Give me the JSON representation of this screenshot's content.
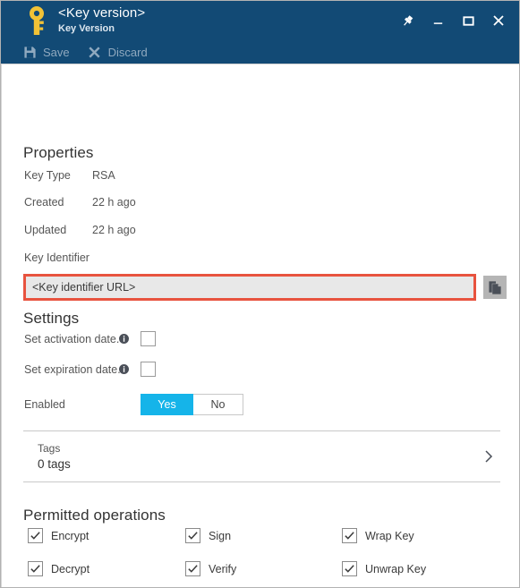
{
  "window": {
    "title": "<Key version>",
    "subtitle": "Key Version",
    "icon": "key-icon",
    "buttons": [
      {
        "name": "pin-button",
        "icon": "pin-icon"
      },
      {
        "name": "minimize-button",
        "icon": "minimize-icon"
      },
      {
        "name": "maximize-button",
        "icon": "maximize-icon"
      },
      {
        "name": "close-button",
        "icon": "close-icon"
      }
    ]
  },
  "commandbar": {
    "items": [
      {
        "name": "save-button",
        "label": "Save",
        "icon": "save-icon",
        "enabled": false
      },
      {
        "name": "discard-button",
        "label": "Discard",
        "icon": "discard-icon",
        "enabled": false
      }
    ]
  },
  "properties": {
    "heading": "Properties",
    "rows": [
      {
        "label": "Key Type",
        "value": "RSA"
      },
      {
        "label": "Created",
        "value": "22 h ago"
      },
      {
        "label": "Updated",
        "value": "22 h ago"
      }
    ],
    "key_identifier_label": "Key Identifier",
    "key_identifier_value": "<Key identifier URL>",
    "key_identifier_placeholder": "<Key identifier URL>",
    "copy_button": {
      "name": "copy-button",
      "icon": "copy-icon"
    },
    "highlight_color": "#e8533f"
  },
  "settings": {
    "heading": "Settings",
    "activation": {
      "label": "Set activation date.",
      "info": "info-icon",
      "checked": false
    },
    "expiration": {
      "label": "Set expiration date.",
      "info": "info-icon",
      "checked": false
    },
    "enabled": {
      "label": "Enabled",
      "yes_label": "Yes",
      "no_label": "No",
      "selected": "Yes",
      "accent_color": "#15b4e9"
    }
  },
  "tags": {
    "title": "Tags",
    "count_label": "0 tags",
    "chevron": "chevron-right-icon"
  },
  "permitted_operations": {
    "heading": "Permitted operations",
    "items": [
      {
        "label": "Encrypt",
        "checked": true
      },
      {
        "label": "Sign",
        "checked": true
      },
      {
        "label": "Wrap Key",
        "checked": true
      },
      {
        "label": "Decrypt",
        "checked": true
      },
      {
        "label": "Verify",
        "checked": true
      },
      {
        "label": "Unwrap Key",
        "checked": true
      }
    ]
  },
  "theme": {
    "titlebar_color": "#124a75",
    "accent_color": "#15b4e9",
    "highlight_color": "#e8533f",
    "text_color": "#555555"
  }
}
